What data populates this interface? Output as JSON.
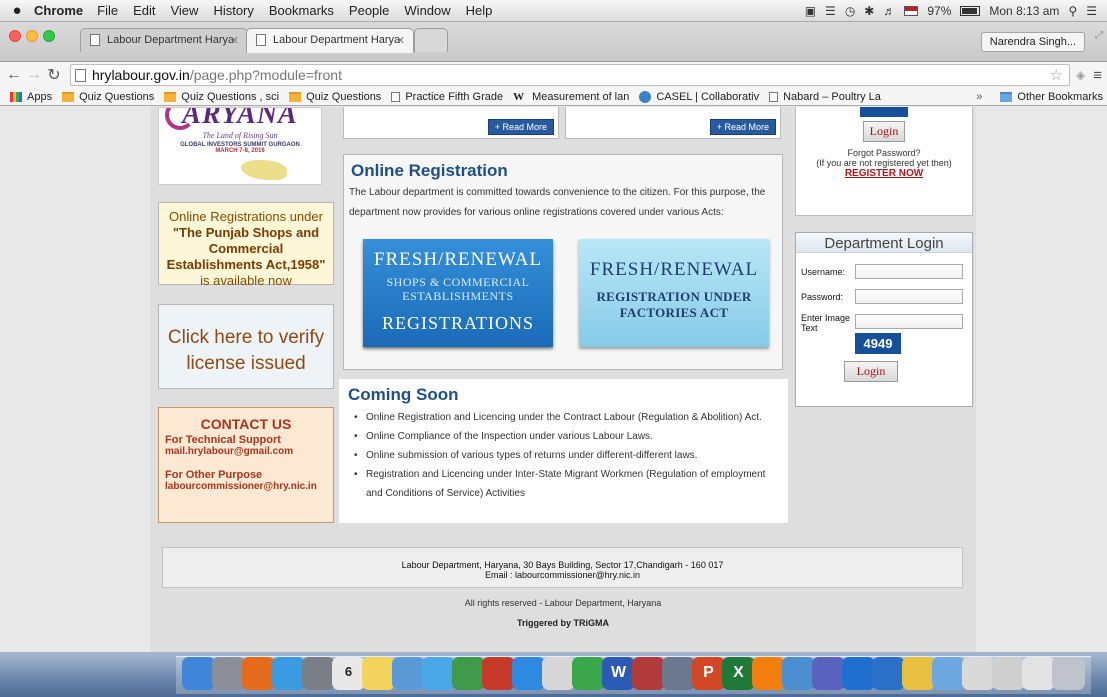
{
  "menubar": {
    "app": "Chrome",
    "items": [
      "File",
      "Edit",
      "View",
      "History",
      "Bookmarks",
      "People",
      "Window",
      "Help"
    ],
    "battery": "97%",
    "clock": "Mon 8:13 am"
  },
  "tabs": [
    {
      "label": "Labour Department Harya"
    },
    {
      "label": "Labour Department Harya"
    }
  ],
  "profile": "Narendra Singh...",
  "address": {
    "host": "hrylabour.gov.in",
    "path": "/page.php?module=front"
  },
  "bookmarks": {
    "items": [
      {
        "label": "Apps",
        "icon": "apps-grid-icon"
      },
      {
        "label": "Quiz Questions",
        "icon": "folder-icon"
      },
      {
        "label": "Quiz Questions , sci",
        "icon": "folder-icon"
      },
      {
        "label": "Quiz Questions",
        "icon": "folder-icon"
      },
      {
        "label": "Practice Fifth Grade",
        "icon": "page-icon"
      },
      {
        "label": "Measurement of lan",
        "icon": "wikipedia-icon"
      },
      {
        "label": "CASEL | Collaborativ",
        "icon": "casel-icon"
      },
      {
        "label": "Nabard – Poultry La",
        "icon": "page-icon"
      }
    ],
    "overflow": "»",
    "other": "Other Bookmarks"
  },
  "logo": {
    "wordmark": "ARYANA",
    "tagline": "The Land of Rising Sun",
    "summit": "GLOBAL INVESTORS SUMMIT GURGAON",
    "dates": "MARCH 7-8, 2016"
  },
  "left": {
    "reg_note_prefix": "Online Registrations under",
    "reg_note_act": "\"The Punjab Shops and Commercial Establishments Act,1958\"",
    "reg_note_suffix": " is available now",
    "verify": "Click here to verify license issued",
    "contact_title": "CONTACT US",
    "tech_label": "For Technical Support",
    "tech_email": "mail.hrylabour@gmail.com",
    "other_label": "For Other Purpose",
    "other_email": "labourcommissioner@hry.nic.in"
  },
  "news": {
    "read_more": "+ Read More"
  },
  "online_registration": {
    "title": "Online Registration",
    "intro": "The Labour department is committed towards convenience to the citizen. For this purpose, the department now provides for various online registrations covered under various Acts:",
    "tile_shops": {
      "line1": "FRESH/RENEWAL",
      "line2": "SHOPS & COMMERCIAL ESTABLISHMENTS",
      "line3": "REGISTRATIONS"
    },
    "tile_factories": {
      "line1": "FRESH/RENEWAL",
      "line2": "REGISTRATION UNDER FACTORIES ACT"
    }
  },
  "coming_soon": {
    "title": "Coming Soon",
    "items": [
      "Online Registration and Licencing under the Contract Labour (Regulation & Abolition) Act.",
      "Online Compliance of the Inspection under various Labour Laws.",
      "Online submission of various types of returns under different-different laws.",
      "Registration and Licencing under Inter-State Migrant Workmen (Regulation of employment and Conditions of Service) Activities"
    ]
  },
  "member_login": {
    "login": "Login",
    "forgot": "Forgot Password?",
    "not_registered": "(If you are not registered yet then)",
    "register": "REGISTER NOW"
  },
  "dept_login": {
    "title": "Department Login",
    "username_label": "Username:",
    "password_label": "Password:",
    "image_text_label": "Enter Image Text",
    "captcha": "4949",
    "login": "Login"
  },
  "footer": {
    "address": "Labour Department, Haryana, 30 Bays Building, Sector 17,Chandigarh - 160 017",
    "email": "Email : labourcommissioner@hry.nic.in",
    "rights": "All rights reserved - Labour Department, Haryana",
    "trigger": "Triggered by TRiGMA"
  },
  "dock": {
    "apps": [
      {
        "icon": "finder-icon",
        "color": "#3f86d8"
      },
      {
        "icon": "launchpad-icon",
        "color": "#8a8f99"
      },
      {
        "icon": "firefox-icon",
        "color": "#e46a1c"
      },
      {
        "icon": "safari-icon",
        "color": "#3a9be0"
      },
      {
        "icon": "system-preferences-icon",
        "color": "#7a7e86"
      },
      {
        "icon": "calendar-icon",
        "color": "#e8e8e8"
      },
      {
        "icon": "notes-icon",
        "color": "#f2d35b"
      },
      {
        "icon": "preview-icon",
        "color": "#5b9ad6"
      },
      {
        "icon": "messages-icon",
        "color": "#4aa8e8"
      },
      {
        "icon": "facetime-icon",
        "color": "#3f9a4a"
      },
      {
        "icon": "photo-booth-icon",
        "color": "#c73a2a"
      },
      {
        "icon": "app-store-icon",
        "color": "#2d8ae0"
      },
      {
        "icon": "textedit-icon",
        "color": "#d7d7d7"
      },
      {
        "icon": "numbers-icon",
        "color": "#3aa84a"
      },
      {
        "icon": "word-icon",
        "color": "#2b5bb5"
      },
      {
        "icon": "dictionary-icon",
        "color": "#b23a3a"
      },
      {
        "icon": "image-capture-icon",
        "color": "#6b7890"
      },
      {
        "icon": "powerpoint-icon",
        "color": "#d24726"
      },
      {
        "icon": "excel-icon",
        "color": "#1f7a3a"
      },
      {
        "icon": "vlc-icon",
        "color": "#f07f10"
      },
      {
        "icon": "image-icon",
        "color": "#4b8fd0"
      },
      {
        "icon": "star-app-icon",
        "color": "#5a62c0"
      },
      {
        "icon": "teamviewer-icon",
        "color": "#1f6fd0"
      },
      {
        "icon": "network-icon",
        "color": "#2a70c8"
      },
      {
        "icon": "chrome-icon",
        "color": "#e8c040"
      },
      {
        "icon": "downloads-folder-icon",
        "color": "#6ea8e0"
      },
      {
        "icon": "documents-icon",
        "color": "#d9d9d9"
      },
      {
        "icon": "files-icon",
        "color": "#cfcfcf"
      },
      {
        "icon": "archive-icon",
        "color": "#e3e3e3"
      },
      {
        "icon": "trash-icon",
        "color": "#bfc4cc"
      }
    ],
    "labels": {
      "calendar": "6",
      "word": "W",
      "powerpoint": "P",
      "excel": "X"
    }
  }
}
